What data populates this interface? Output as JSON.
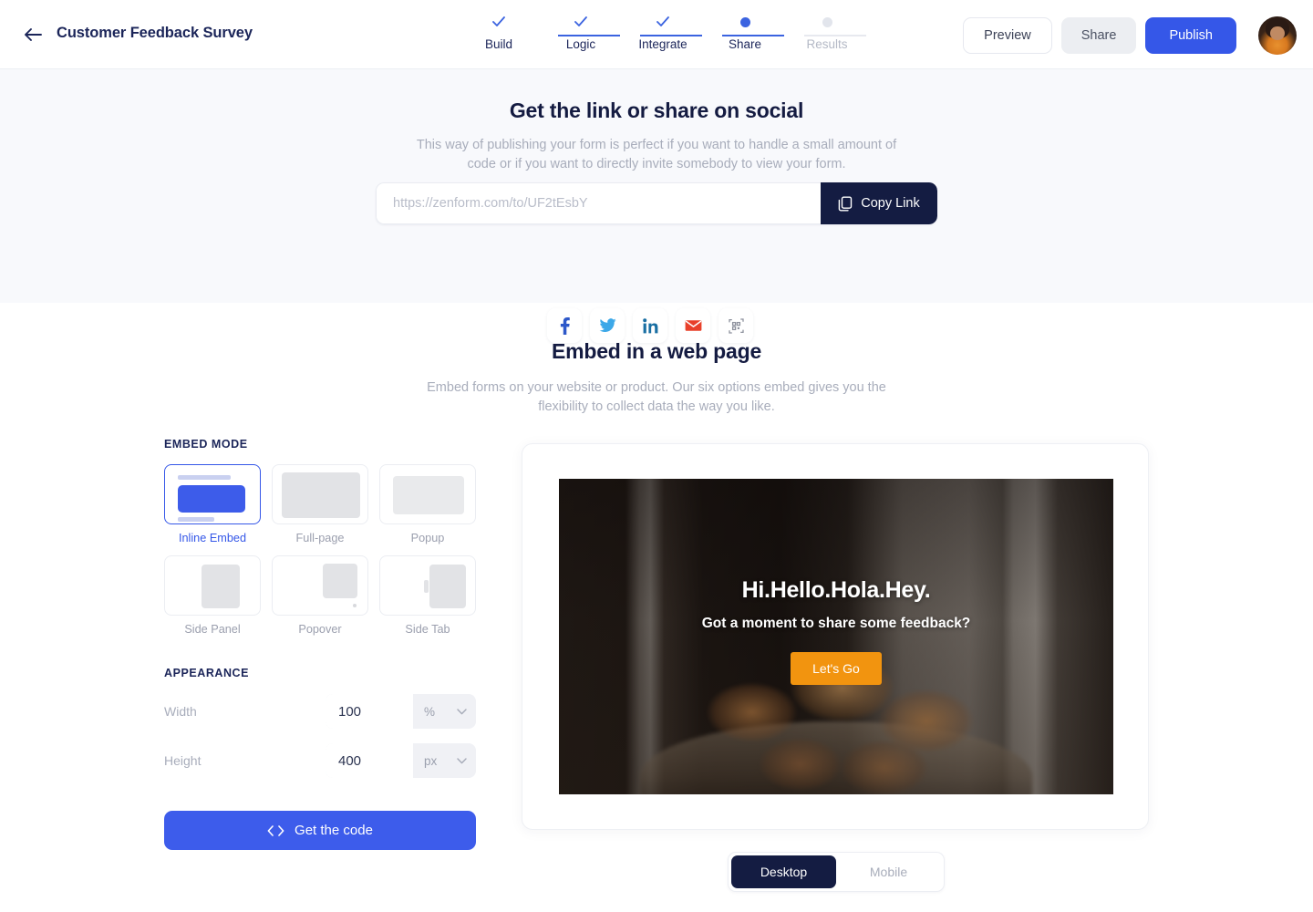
{
  "header": {
    "back_icon": "arrow-left-icon",
    "title": "Customer Feedback Survey",
    "steps": [
      {
        "label": "Build",
        "state": "done"
      },
      {
        "label": "Logic",
        "state": "done"
      },
      {
        "label": "Integrate",
        "state": "done"
      },
      {
        "label": "Share",
        "state": "current"
      },
      {
        "label": "Results",
        "state": "upcoming"
      }
    ],
    "preview_label": "Preview",
    "share_label": "Share",
    "publish_label": "Publish",
    "avatar_name": "user-avatar"
  },
  "link_section": {
    "title": "Get the link or share on social",
    "subtitle": "This way of publishing your form is perfect if you want to handle a small amount of code or if you want to directly invite somebody to view your form.",
    "url": "https://zenform.com/to/UF2tEsbY",
    "copy_label": "Copy Link",
    "socials": [
      {
        "name": "facebook",
        "glyph": "f"
      },
      {
        "name": "twitter",
        "glyph": "t"
      },
      {
        "name": "linkedin",
        "glyph": "in"
      },
      {
        "name": "email",
        "glyph": "envelope"
      },
      {
        "name": "qr-code",
        "glyph": "qr"
      }
    ]
  },
  "embed_section": {
    "title": "Embed in a web page",
    "subtitle": "Embed forms on your website or product. Our six options embed gives you the flexibility to collect data the way you like.",
    "embed_mode_label": "EMBED MODE",
    "modes": [
      {
        "label": "Inline Embed",
        "selected": true
      },
      {
        "label": "Full-page",
        "selected": false
      },
      {
        "label": "Popup",
        "selected": false
      },
      {
        "label": "Side Panel",
        "selected": false
      },
      {
        "label": "Popover",
        "selected": false
      },
      {
        "label": "Side Tab",
        "selected": false
      }
    ],
    "appearance_label": "APPEARANCE",
    "width": {
      "label": "Width",
      "value": "100",
      "unit": "%"
    },
    "height": {
      "label": "Height",
      "value": "400",
      "unit": "px"
    },
    "get_code_label": "Get the code"
  },
  "preview": {
    "heading": "Hi.Hello.Hola.Hey.",
    "subheading": "Got a moment to share some feedback?",
    "cta_label": "Let's Go",
    "devices": [
      {
        "label": "Desktop",
        "active": true
      },
      {
        "label": "Mobile",
        "active": false
      }
    ]
  },
  "colors": {
    "accent_blue": "#3557e8",
    "code_blue": "#3d5ceb",
    "dark_navy": "#141c42",
    "cta_orange": "#f2940f",
    "muted_text": "#a8adbb",
    "panel_bg": "#f8f9fc"
  }
}
